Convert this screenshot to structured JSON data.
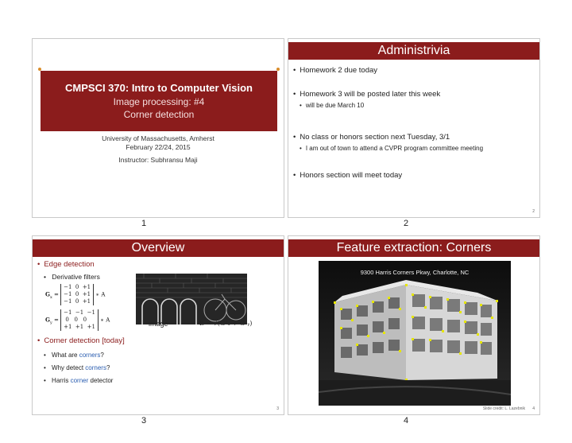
{
  "slide1": {
    "title": "CMPSCI 370: Intro to Computer Vision",
    "subtitle1": "Image processing: #4",
    "subtitle2": "Corner detection",
    "university": "University of Massachusetts, Amherst",
    "date": "February 22/24, 2015",
    "instructor": "Instructor: Subhransu Maji",
    "page": "1"
  },
  "slide2": {
    "title": "Administrivia",
    "bullets": [
      "Homework 2 due today",
      "Homework 3 will be posted later this week",
      "will be due March 10",
      "No class or honors section next Tuesday, 3/1",
      "I am out of town to attend a CVPR program committee meeting",
      "Honors section will meet today"
    ],
    "small_num": "2",
    "page": "2"
  },
  "slide3": {
    "title": "Overview",
    "edge": "Edge detection",
    "derivative": "Derivative",
    "filters": " filters",
    "gx_label": "G",
    "gx_sub": "x",
    "gy_sub": "y",
    "eq": " =",
    "gx_rows": [
      "−1  0  +1",
      "−1  0  +1",
      "−1  0  +1"
    ],
    "gy_rows": [
      "−1  −1  −1",
      " 0   0   0",
      "+1  +1  +1"
    ],
    "conv": "∗ A",
    "image_label": "image",
    "mag_formula": "E = √(G²ₓ + G²ᵧ)",
    "corner_section": "Corner detection [today]",
    "q1a": "What are ",
    "q1b": "corners",
    "q1c": "?",
    "q2a": "Why detect ",
    "q2b": "corners",
    "q2c": "?",
    "q3a": "Harris ",
    "q3b": "corner",
    "q3c": " detector",
    "small_num": "3",
    "page": "3"
  },
  "slide4": {
    "title": "Feature extraction: Corners",
    "caption": "9300 Harris Corners Pkwy, Charlotte, NC",
    "credit": "Slide credit: L. Lazebnik",
    "small_num": "4",
    "page": "4"
  },
  "colors": {
    "accent": "#8b1c1c",
    "link": "#2a5db0",
    "corner_marks": "#e6e600"
  }
}
